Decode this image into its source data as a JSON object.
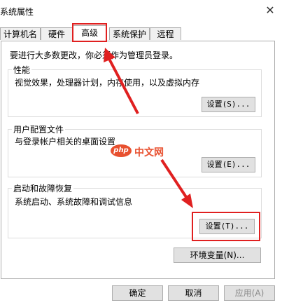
{
  "window": {
    "title": "系统属性",
    "close_glyph": "✕"
  },
  "tabs": [
    {
      "label": "计算机名",
      "active": false
    },
    {
      "label": "硬件",
      "active": false
    },
    {
      "label": "高级",
      "active": true
    },
    {
      "label": "系统保护",
      "active": false
    },
    {
      "label": "远程",
      "active": false
    }
  ],
  "main": {
    "admin_note": "要进行大多数更改，你必须作为管理员登录。",
    "performance": {
      "title": "性能",
      "desc": "视觉效果，处理器计划，内存使用，以及虚拟内存",
      "button": "设置(S)..."
    },
    "user_profiles": {
      "title": "用户配置文件",
      "desc": "与登录帐户相关的桌面设置",
      "button": "设置(E)..."
    },
    "startup_recovery": {
      "title": "启动和故障恢复",
      "desc": "系统启动、系统故障和调试信息",
      "button": "设置(T)..."
    },
    "env_button": "环境变量(N)..."
  },
  "footer": {
    "ok": "确定",
    "cancel": "取消",
    "apply": "应用(A)"
  },
  "watermark": {
    "logo_text": "php",
    "text": "中文网"
  },
  "colors": {
    "annotation_red": "#e02020",
    "watermark_orange": "#e8502f"
  },
  "icons": {
    "close": "close-icon",
    "annotation_arrows": "red-arrow-icon"
  }
}
